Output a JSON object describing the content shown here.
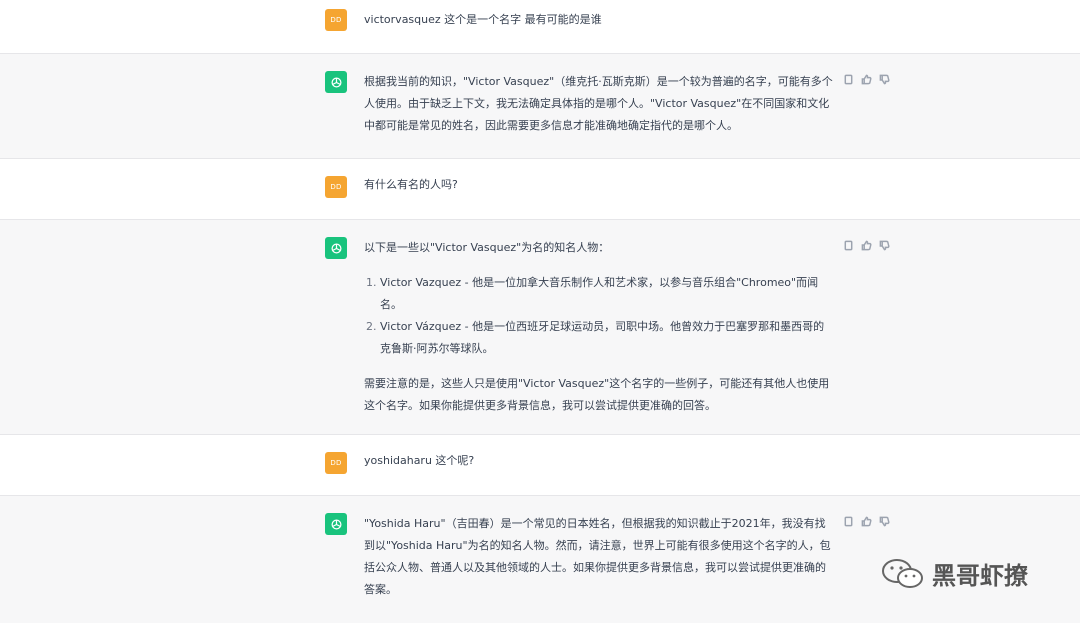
{
  "user_initials": "DD",
  "conversation": [
    {
      "role": "user",
      "text": "victorvasquez 这个是一个名字 最有可能的是谁"
    },
    {
      "role": "assistant",
      "paragraphs": [
        "根据我当前的知识，\"Victor Vasquez\"（维克托·瓦斯克斯）是一个较为普遍的名字，可能有多个人使用。由于缺乏上下文，我无法确定具体指的是哪个人。\"Victor Vasquez\"在不同国家和文化中都可能是常见的姓名，因此需要更多信息才能准确地确定指代的是哪个人。"
      ]
    },
    {
      "role": "user",
      "text": "有什么有名的人吗?"
    },
    {
      "role": "assistant",
      "intro": "以下是一些以\"Victor Vasquez\"为名的知名人物：",
      "list": [
        "Victor Vazquez - 他是一位加拿大音乐制作人和艺术家，以参与音乐组合\"Chromeo\"而闻名。",
        "Victor Vázquez - 他是一位西班牙足球运动员，司职中场。他曾效力于巴塞罗那和墨西哥的克鲁斯·阿苏尔等球队。"
      ],
      "outro": "需要注意的是，这些人只是使用\"Victor Vasquez\"这个名字的一些例子，可能还有其他人也使用这个名字。如果你能提供更多背景信息，我可以尝试提供更准确的回答。"
    },
    {
      "role": "user",
      "text": "yoshidaharu 这个呢?"
    },
    {
      "role": "assistant",
      "paragraphs": [
        "\"Yoshida Haru\"（吉田春）是一个常见的日本姓名，但根据我的知识截止于2021年，我没有找到以\"Yoshida Haru\"为名的知名人物。然而，请注意，世界上可能有很多使用这个名字的人，包括公众人物、普通人以及其他领域的人士。如果你提供更多背景信息，我可以尝试提供更准确的答案。"
      ]
    }
  ],
  "watermark": "黑哥虾撩",
  "colors": {
    "accent": "#19c37d",
    "user_avatar": "#f5a531"
  },
  "icons": [
    "sidebar-toggle-icon",
    "copy-icon",
    "thumbs-up-icon",
    "thumbs-down-icon",
    "wechat-icon"
  ]
}
